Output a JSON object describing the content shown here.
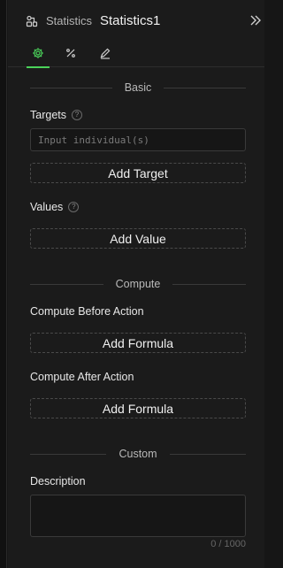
{
  "header": {
    "icon": "statistics-node-icon",
    "type_label": "Statistics",
    "name": "Statistics1",
    "collapse_icon": "double-chevron-right-icon"
  },
  "tabs": [
    {
      "icon": "gear-icon",
      "active": true,
      "active_color": "#4bd35a"
    },
    {
      "icon": "percent-icon",
      "active": false
    },
    {
      "icon": "pencil-icon",
      "active": false
    }
  ],
  "sections": {
    "basic": "Basic",
    "compute": "Compute",
    "custom": "Custom"
  },
  "targets": {
    "label": "Targets",
    "placeholder": "Input individual(s)",
    "value": "",
    "add_label": "Add Target"
  },
  "values": {
    "label": "Values",
    "add_label": "Add Value"
  },
  "compute_before": {
    "label": "Compute Before Action",
    "add_label": "Add Formula"
  },
  "compute_after": {
    "label": "Compute After Action",
    "add_label": "Add Formula"
  },
  "description": {
    "label": "Description",
    "value": "",
    "counter": "0 / 1000"
  }
}
